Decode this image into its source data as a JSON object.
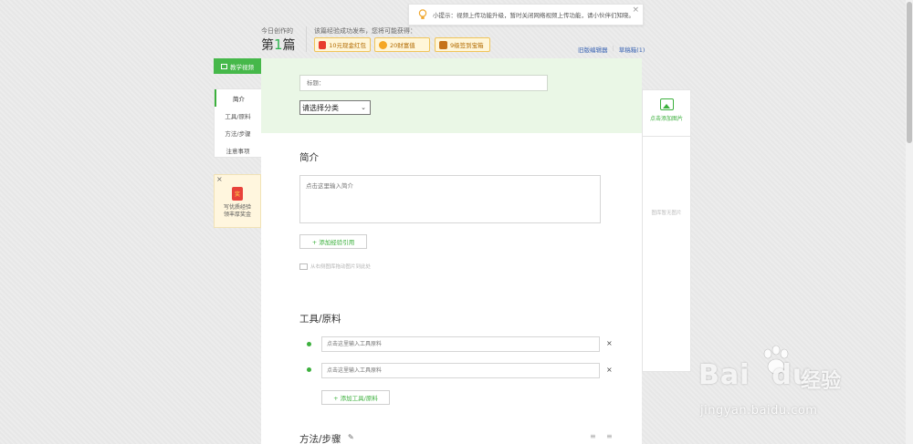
{
  "tip": {
    "text": "小提示：视频上传功能升级，暂时关闭网络视频上传功能，请小伙伴们知晓。",
    "close": "×"
  },
  "header": {
    "today_label": "今日创作的",
    "count_prefix": "第",
    "count_num": "1",
    "count_suffix": "篇",
    "reward_title": "该篇经验成功发布，您将可能获得：",
    "rewards": [
      "10元现金红包",
      "20财富值",
      "9级签到宝箱"
    ],
    "links": [
      "旧版编辑器",
      "草稿箱(1)"
    ]
  },
  "nav": {
    "teach_video": "教学视频",
    "items": [
      "简介",
      "工具/原料",
      "方法/步骤",
      "注意事项"
    ]
  },
  "promo": {
    "icon_text": "奖",
    "line1": "写优质经验",
    "line2": "领丰厚奖金",
    "close": "×"
  },
  "editor": {
    "title_placeholder": "标题：",
    "category_selected": "请选择分类",
    "intro_heading": "简介",
    "intro_placeholder": "点击这里输入简介",
    "add_ref_btn": "+ 添加经验引用",
    "drag_hint": "从右侧图库拖动图片到此处",
    "tools_heading": "工具/原料",
    "tool_placeholder": "点击这里输入工具原料",
    "add_tool_btn": "+ 添加工具/原料",
    "steps_heading": "方法/步骤",
    "remove": "×"
  },
  "right_panel": {
    "add_image": "点击添加图片",
    "empty": "图库暂无图片"
  },
  "watermark": {
    "brand": "Bai",
    "brand2": "du",
    "jingyan": "经验",
    "url": "jingyan.baidu.com"
  }
}
